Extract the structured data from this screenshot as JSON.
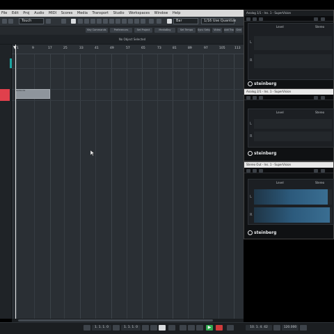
{
  "menubar": {
    "items": [
      "File",
      "Edit",
      "Proj",
      "Audio",
      "MIDI",
      "Scores",
      "Media",
      "Transport",
      "Studio",
      "Workspaces",
      "Window",
      "Help"
    ]
  },
  "toolbar": {
    "automation_mode": "Touch",
    "snap_value": "Bar",
    "quantize": "1/16 Use Quantize"
  },
  "subbar": {
    "buttons": [
      "Key Commands",
      "Preferences",
      "Set Project",
      "MediaBay",
      "Set Tempo",
      "Sync Setup",
      "Video",
      "Add Track",
      "Grid"
    ]
  },
  "info": {
    "no_object": "No Object Selected"
  },
  "ruler": {
    "marks": [
      "1",
      "9",
      "17",
      "25",
      "33",
      "41",
      "49",
      "57",
      "65",
      "73",
      "81",
      "89",
      "97",
      "105",
      "113"
    ]
  },
  "part": {
    "label": "Audio 01"
  },
  "transport": {
    "left_locator": "1. 1. 1. 0",
    "right_locator": "1. 1. 1. 0",
    "position": "10. 1. 4. 42",
    "tempo": "120.000"
  },
  "plugins": [
    {
      "title": "Analog 1/1 - Ins. 1 - SuperVision",
      "level_label": "Level",
      "stereo_label": "Stereo",
      "logo": "steinberg",
      "ch_l": "L",
      "ch_r": "R"
    },
    {
      "title": "Analog 2/1 - Ins. 1 - SuperVision",
      "level_label": "Level",
      "stereo_label": "Stereo",
      "logo": "steinberg",
      "ch_l": "L",
      "ch_r": "R"
    },
    {
      "title": "Stereo Out - Ins. 1 - SuperVision",
      "level_label": "Level",
      "stereo_label": "Stereo",
      "logo": "steinberg",
      "ch_l": "L",
      "ch_r": "R"
    }
  ],
  "colors": {
    "track_red": "#e0404c",
    "meter_blue": "#2c5a7c",
    "play_green": "#2fa84f",
    "record_red": "#cf3b3b"
  },
  "level": {
    "plugin3_left": 0.95,
    "plugin3_right": 0.97
  }
}
